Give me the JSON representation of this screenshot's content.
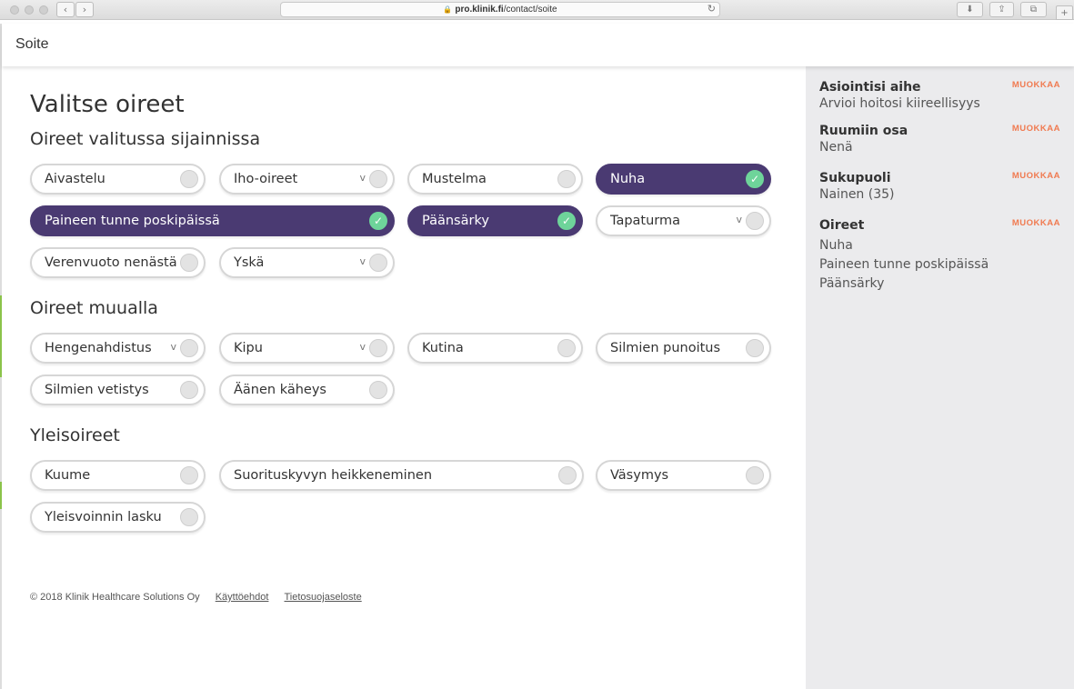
{
  "browser": {
    "url_domain": "pro.klinik.fi",
    "url_path": "/contact/soite"
  },
  "header": {
    "title": "Soite"
  },
  "page_title": "Valitse oireet",
  "sections": [
    {
      "title": "Oireet valitussa sijainnissa",
      "symptoms": [
        {
          "label": "Aivastelu",
          "dropdown": false,
          "selected": false
        },
        {
          "label": "Iho-oireet",
          "dropdown": true,
          "selected": false
        },
        {
          "label": "Mustelma",
          "dropdown": false,
          "selected": false
        },
        {
          "label": "Nuha",
          "dropdown": false,
          "selected": true
        },
        {
          "label": "Paineen tunne poskipäissä",
          "dropdown": false,
          "selected": true
        },
        {
          "label": "Päänsärky",
          "dropdown": false,
          "selected": true
        },
        {
          "label": "Tapaturma",
          "dropdown": true,
          "selected": false
        },
        {
          "label": "Verenvuoto nenästä",
          "dropdown": false,
          "selected": false
        },
        {
          "label": "Yskä",
          "dropdown": true,
          "selected": false
        }
      ]
    },
    {
      "title": "Oireet muualla",
      "symptoms": [
        {
          "label": "Hengenahdistus",
          "dropdown": true,
          "selected": false
        },
        {
          "label": "Kipu",
          "dropdown": true,
          "selected": false
        },
        {
          "label": "Kutina",
          "dropdown": false,
          "selected": false
        },
        {
          "label": "Silmien punoitus",
          "dropdown": false,
          "selected": false
        },
        {
          "label": "Silmien vetistys",
          "dropdown": false,
          "selected": false
        },
        {
          "label": "Äänen käheys",
          "dropdown": false,
          "selected": false
        }
      ]
    },
    {
      "title": "Yleisoireet",
      "symptoms": [
        {
          "label": "Kuume",
          "dropdown": false,
          "selected": false
        },
        {
          "label": "Suorituskyvyn heikkeneminen",
          "dropdown": false,
          "selected": false
        },
        {
          "label": "Väsymys",
          "dropdown": false,
          "selected": false
        },
        {
          "label": "Yleisvoinnin lasku",
          "dropdown": false,
          "selected": false
        }
      ]
    }
  ],
  "dropdown_glyph": "v",
  "check_glyph": "✓",
  "footer": {
    "copyright": "© 2018 Klinik Healthcare Solutions Oy",
    "links": [
      "Käyttöehdot",
      "Tietosuojaseloste"
    ]
  },
  "sidebar": {
    "edit_label": "MUOKKAA",
    "sections": [
      {
        "heading": "Asiointisi aihe",
        "values": [
          "Arvioi hoitosi kiireellisyys"
        ]
      },
      {
        "heading": "Ruumiin osa",
        "values": [
          "Nenä"
        ]
      },
      {
        "heading": "Sukupuoli",
        "values": [
          "Nainen (35)"
        ]
      },
      {
        "heading": "Oireet",
        "values": [
          "Nuha",
          "Paineen tunne poskipäissä",
          "Päänsärky"
        ]
      }
    ]
  },
  "colors": {
    "selected_pill": "#4a3a72",
    "check_circle": "#6ed49a",
    "edit_link": "#f07a50",
    "sidebar_bg": "#ebebed"
  }
}
